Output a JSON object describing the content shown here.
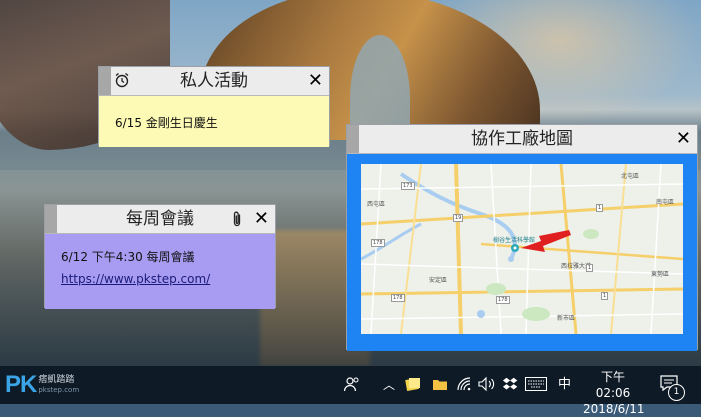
{
  "notes": {
    "personal": {
      "title": "私人活動",
      "text": "6/15 金剛生日慶生",
      "background": "#fdfab5"
    },
    "weekly": {
      "title": "每周會議",
      "text": "6/12 下午4:30 每周會議",
      "link": "https://www.pkstep.com/",
      "background": "#a79cf2"
    },
    "map": {
      "title": "協作工廠地圖",
      "background": "#1e84f4",
      "map_labels": {
        "district_xitun": "西屯區",
        "district_beitun": "北屯區",
        "district_xitun2": "南屯區",
        "district_dongshi": "東勢區",
        "district_anxin": "安定區",
        "district_xinshi": "新市區",
        "poi": "樹谷生活科學館",
        "road": "西拉雅大道"
      },
      "road_numbers": [
        "173",
        "178",
        "19",
        "1",
        "1",
        "178",
        "178",
        "1"
      ]
    }
  },
  "taskbar": {
    "logo_pk": "PK",
    "logo_cn": "痞凱踏踏",
    "logo_url": "pkstep.com",
    "ime": "中",
    "time": "下午 02:06",
    "date": "2018/6/11",
    "notification_count": "1"
  },
  "colors": {
    "taskbar": "#0e1a26",
    "note_header": "#ececec",
    "grip": "#a7a7a7"
  }
}
